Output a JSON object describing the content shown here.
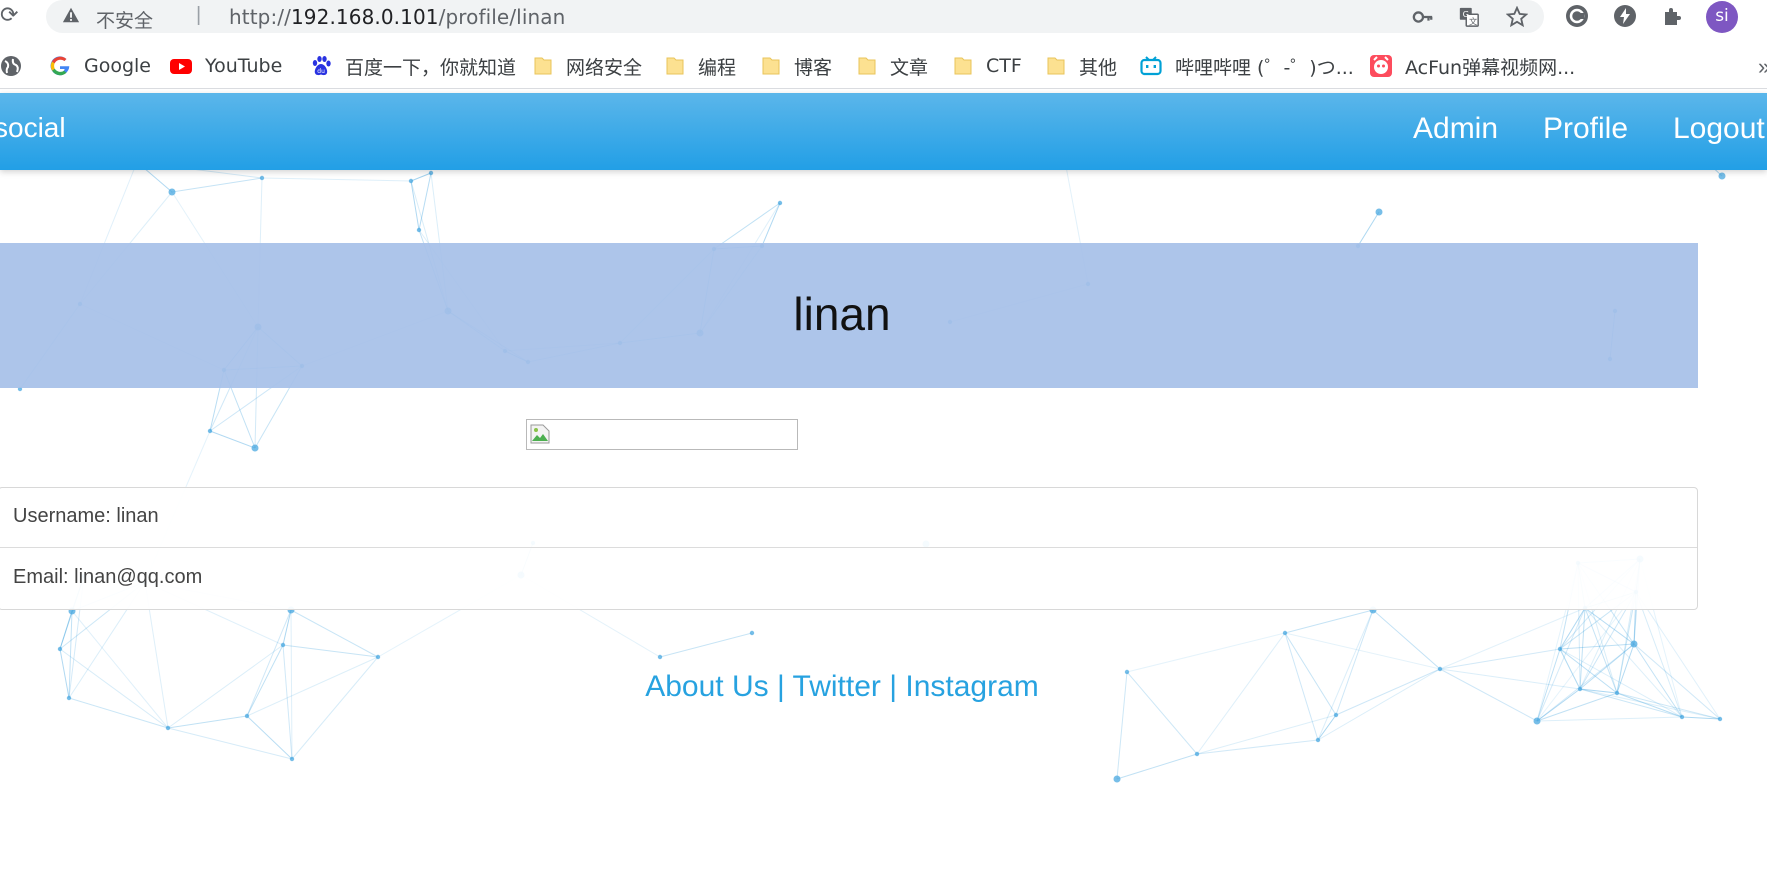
{
  "browser": {
    "security_label": "不安全",
    "separator": "|",
    "url_prefix": "http://",
    "url_host": "192.168.0.101",
    "url_path": "/profile/linan",
    "avatar_initials": "si"
  },
  "bookmarks": [
    {
      "label": "Google",
      "icon": "google-icon"
    },
    {
      "label": "YouTube",
      "icon": "youtube-icon"
    },
    {
      "label": "百度一下，你就知道",
      "icon": "baidu-icon"
    },
    {
      "label": "网络安全",
      "icon": "folder-icon"
    },
    {
      "label": "编程",
      "icon": "folder-icon"
    },
    {
      "label": "博客",
      "icon": "folder-icon"
    },
    {
      "label": "文章",
      "icon": "folder-icon"
    },
    {
      "label": "CTF",
      "icon": "folder-icon"
    },
    {
      "label": "其他",
      "icon": "folder-icon"
    },
    {
      "label": "哔哩哔哩 (゜-゜)つ...",
      "icon": "bilibili-icon"
    },
    {
      "label": "AcFun弹幕视频网...",
      "icon": "acfun-icon"
    }
  ],
  "navbar": {
    "brand": "social",
    "links": [
      "Admin",
      "Profile",
      "Logout"
    ]
  },
  "profile": {
    "name": "linan",
    "username_line": "Username: linan",
    "email_line": "Email: linan@qq.com"
  },
  "footer": {
    "about": "About Us",
    "sep1": " | ",
    "twitter": "Twitter",
    "sep2": " | ",
    "instagram": "Instagram"
  },
  "colors": {
    "navbar": "#229fe6",
    "banner": "#a6c0e8",
    "link": "#27a2e0",
    "network_lines": "#4aa8e0"
  }
}
